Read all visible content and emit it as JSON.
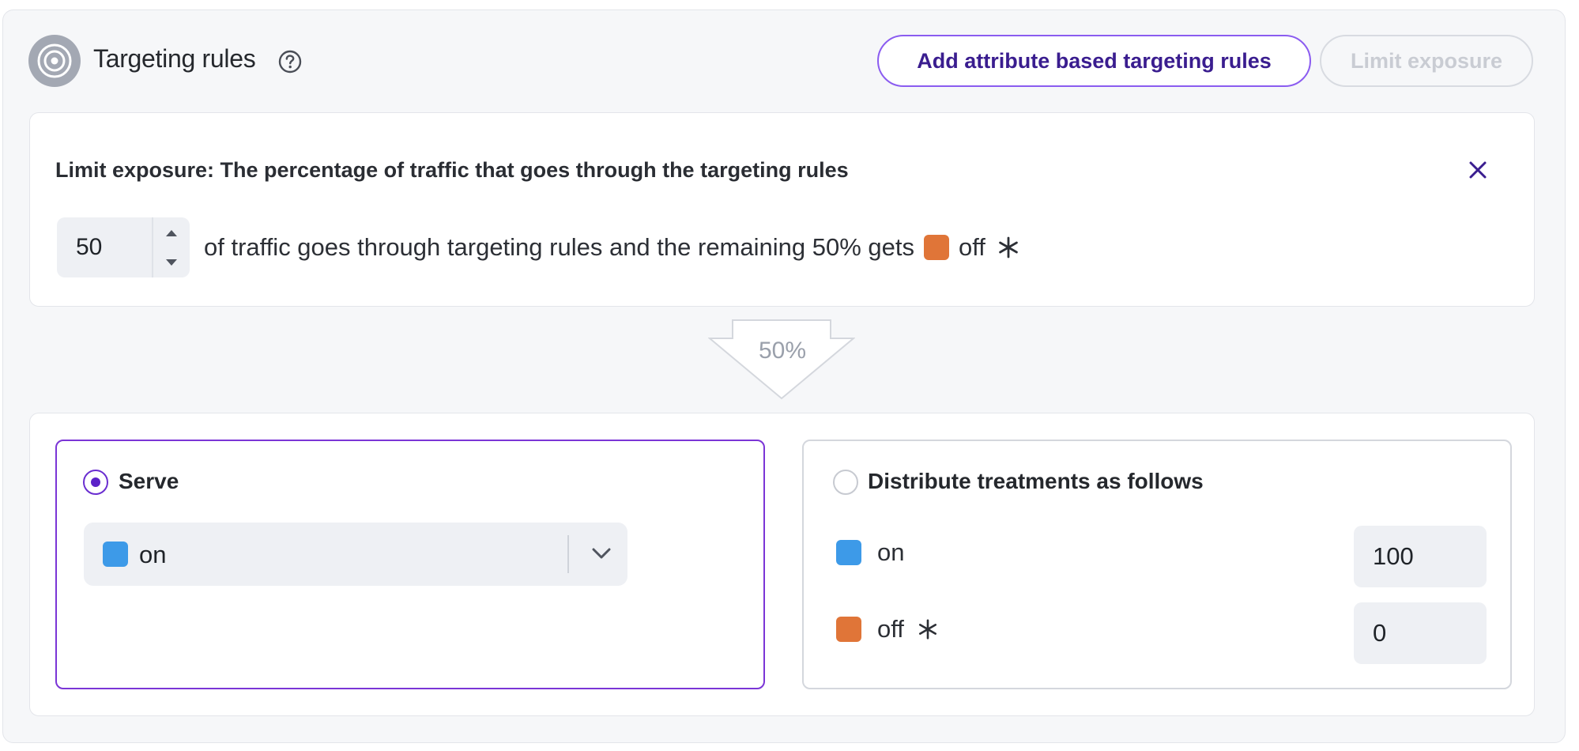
{
  "header": {
    "title": "Targeting rules",
    "add_button_label": "Add attribute based targeting rules",
    "limit_button_label": "Limit exposure"
  },
  "limit_exposure": {
    "title": "Limit exposure: The percentage of traffic that goes through the targeting rules",
    "percentage_value": "50",
    "sentence_part1": "of traffic goes through targeting rules and the remaining 50% gets",
    "remaining_treatment": "off",
    "remaining_treatment_color": "#e07538"
  },
  "flow_arrow": {
    "label": "50%"
  },
  "serve_option": {
    "label": "Serve",
    "selected": true,
    "treatment": "on",
    "treatment_color": "#3d9ae8"
  },
  "distribute_option": {
    "label": "Distribute treatments as follows",
    "selected": false,
    "rows": [
      {
        "treatment": "on",
        "color": "#3d9ae8",
        "value": "100",
        "default": false
      },
      {
        "treatment": "off",
        "color": "#e07538",
        "value": "0",
        "default": true
      }
    ]
  },
  "colors": {
    "accent": "#7b35d6",
    "button_text": "#3a1d8f"
  }
}
